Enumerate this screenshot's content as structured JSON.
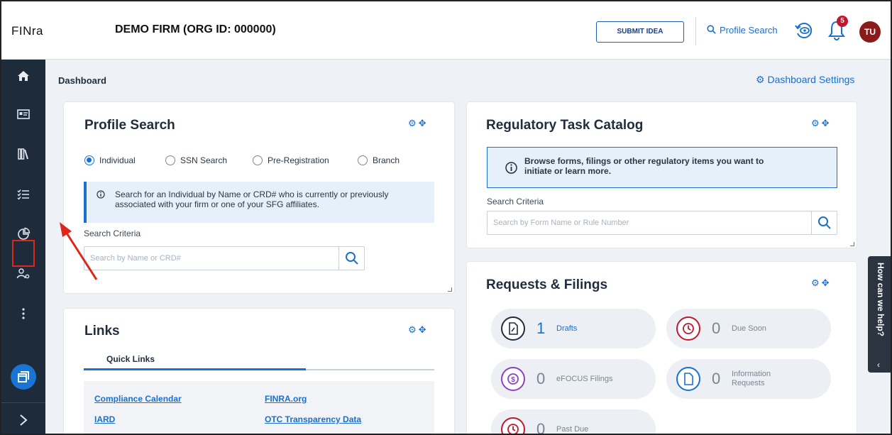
{
  "header": {
    "logo": "FINra",
    "firm_name": "DEMO FIRM (ORG ID: 000000)",
    "submit_idea": "SUBMIT IDEA",
    "profile_search": "Profile Search",
    "notification_count": "5",
    "avatar_initials": "TU"
  },
  "sidebar": {
    "items": [
      "home-icon",
      "id-card-icon",
      "library-icon",
      "task-list-icon",
      "chart-pie-icon",
      "users-gear-icon",
      "more-icon",
      "window-icon",
      "expand-icon"
    ],
    "active_item": "task-list-icon"
  },
  "page": {
    "breadcrumb": "Dashboard",
    "settings_label": "Dashboard Settings"
  },
  "profile_search": {
    "title": "Profile Search",
    "radios": [
      "Individual",
      "SSN Search",
      "Pre-Registration",
      "Branch"
    ],
    "selected": "Individual",
    "info_line1": "Search for an Individual by Name or CRD# who is currently or previously",
    "info_line2": "associated with your firm or one of your SFG affiliates.",
    "criteria_label": "Search Criteria",
    "placeholder": "Search by Name or CRD#"
  },
  "regulatory": {
    "title": "Regulatory Task Catalog",
    "info_line1": "Browse forms, filings or other regulatory items you want to",
    "info_line2": "initiate or learn more.",
    "criteria_label": "Search Criteria",
    "placeholder": "Search by Form Name or Rule Number"
  },
  "links": {
    "title": "Links",
    "tab": "Quick Links",
    "items": [
      "Compliance Calendar",
      "FINRA.org",
      "IARD",
      "OTC Transparency Data"
    ]
  },
  "requests": {
    "title": "Requests & Filings",
    "pills": [
      {
        "count": "1",
        "label": "Drafts"
      },
      {
        "count": "0",
        "label": "Due Soon"
      },
      {
        "count": "0",
        "label": "eFOCUS Filings"
      },
      {
        "count": "0",
        "label_line1": "Information",
        "label_line2": "Requests"
      },
      {
        "count": "0",
        "label": "Past Due"
      }
    ]
  },
  "help": {
    "label": "How can we help?"
  },
  "colors": {
    "accent": "#1a6fd0",
    "sidebar_bg": "#1e2b3a",
    "annotation": "#e0251b",
    "avatar": "#8b1a1a"
  }
}
